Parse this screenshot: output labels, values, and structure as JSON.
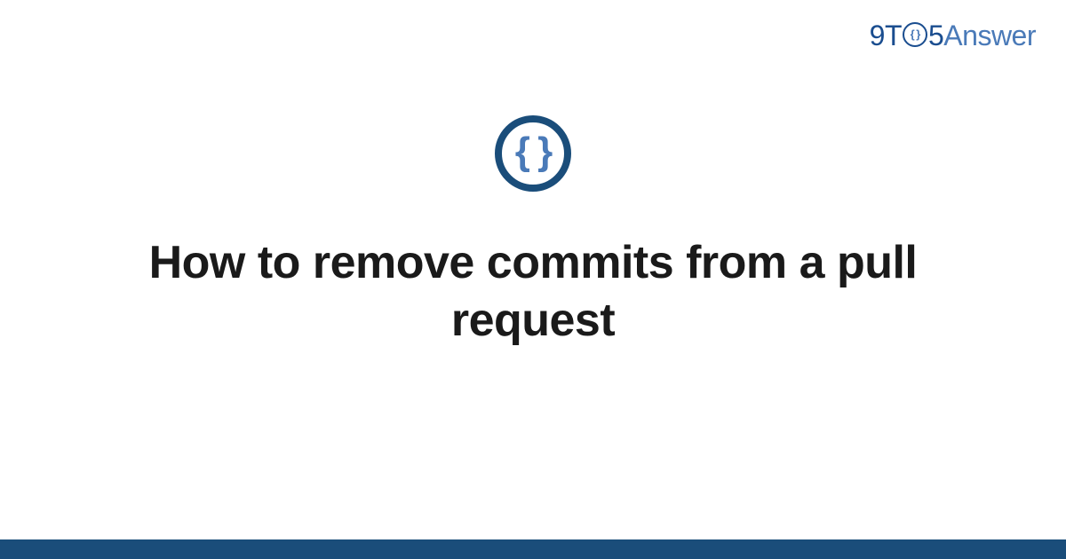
{
  "header": {
    "logo": {
      "part1": "9T",
      "o_inner": "{ }",
      "part2": "5",
      "part3": "Answer"
    }
  },
  "main": {
    "icon_glyph": "{ }",
    "title": "How to remove commits from a pull request"
  },
  "colors": {
    "primary_dark": "#1a4d7a",
    "primary_mid": "#1a4d8f",
    "accent": "#4a7ab8",
    "text": "#1a1a1a"
  }
}
